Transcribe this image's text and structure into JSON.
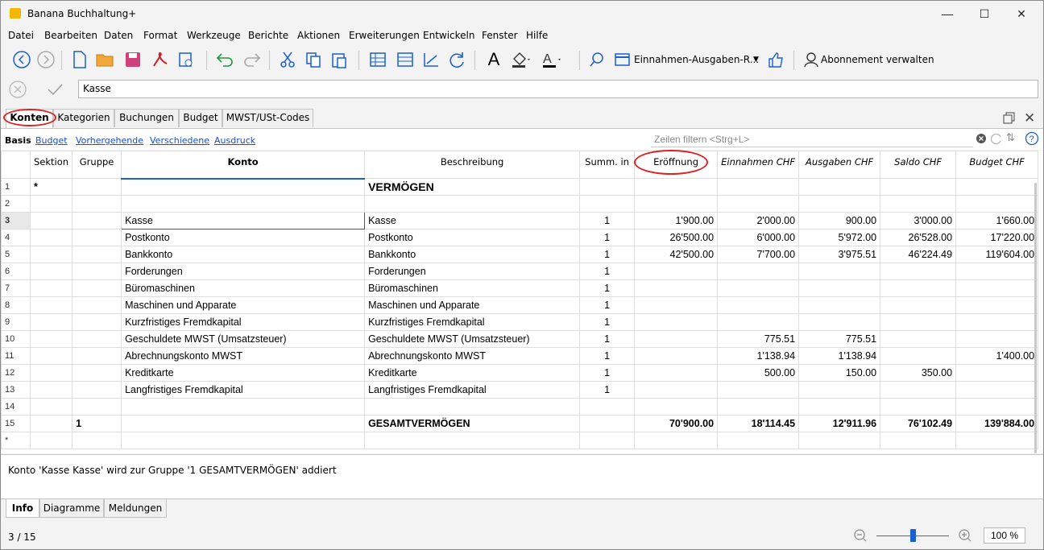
{
  "app": {
    "title": "Banana Buchhaltung+"
  },
  "window_controls": {
    "minimize": "—",
    "maximize": "☐",
    "close": "✕"
  },
  "menu": [
    "Datei",
    "Bearbeiten",
    "Daten",
    "Format",
    "Werkzeuge",
    "Berichte",
    "Aktionen",
    "Erweiterungen",
    "Entwickeln",
    "Fenster",
    "Hilfe"
  ],
  "toolbar": {
    "layout_combo": "Einnahmen-Ausgaben-R...",
    "abo_label": "Abonnement verwalten"
  },
  "edit": {
    "value": "Kasse"
  },
  "tabs": [
    "Konten",
    "Kategorien",
    "Buchungen",
    "Budget",
    "MWST/USt-Codes"
  ],
  "subtabs": {
    "current": "Basis",
    "links": [
      "Budget",
      "Vorhergehende",
      "Verschiedene",
      "Ausdruck"
    ]
  },
  "filter": {
    "placeholder": "Zeilen filtern <Strg+L>"
  },
  "table": {
    "headers": [
      "Sektion",
      "Gruppe",
      "Konto",
      "Beschreibung",
      "Summ. in",
      "Eröffnung",
      "Einnahmen CHF",
      "Ausgaben CHF",
      "Saldo CHF",
      "Budget CHF"
    ],
    "rows": [
      [
        "1",
        "*",
        "",
        "",
        "VERMÖGEN",
        "",
        "",
        "",
        "",
        "",
        ""
      ],
      [
        "2",
        "",
        "",
        "",
        "",
        "",
        "",
        "",
        "",
        "",
        ""
      ],
      [
        "3",
        "",
        "",
        "Kasse",
        "Kasse",
        "1",
        "1'900.00",
        "2'000.00",
        "900.00",
        "3'000.00",
        "1'660.00"
      ],
      [
        "4",
        "",
        "",
        "Postkonto",
        "Postkonto",
        "1",
        "26'500.00",
        "6'000.00",
        "5'972.00",
        "26'528.00",
        "17'220.00"
      ],
      [
        "5",
        "",
        "",
        "Bankkonto",
        "Bankkonto",
        "1",
        "42'500.00",
        "7'700.00",
        "3'975.51",
        "46'224.49",
        "119'604.00"
      ],
      [
        "6",
        "",
        "",
        "Forderungen",
        "Forderungen",
        "1",
        "",
        "",
        "",
        "",
        ""
      ],
      [
        "7",
        "",
        "",
        "Büromaschinen",
        "Büromaschinen",
        "1",
        "",
        "",
        "",
        "",
        ""
      ],
      [
        "8",
        "",
        "",
        "Maschinen und Apparate",
        "Maschinen und Apparate",
        "1",
        "",
        "",
        "",
        "",
        ""
      ],
      [
        "9",
        "",
        "",
        "Kurzfristiges Fremdkapital",
        "Kurzfristiges Fremdkapital",
        "1",
        "",
        "",
        "",
        "",
        ""
      ],
      [
        "10",
        "",
        "",
        "Geschuldete MWST (Umsatzsteuer)",
        "Geschuldete MWST (Umsatzsteuer)",
        "1",
        "",
        "775.51",
        "775.51",
        "",
        ""
      ],
      [
        "11",
        "",
        "",
        "Abrechnungskonto MWST",
        "Abrechnungskonto MWST",
        "1",
        "",
        "1'138.94",
        "1'138.94",
        "",
        "1'400.00"
      ],
      [
        "12",
        "",
        "",
        "Kreditkarte",
        "Kreditkarte",
        "1",
        "",
        "500.00",
        "150.00",
        "350.00",
        ""
      ],
      [
        "13",
        "",
        "",
        "Langfristiges Fremdkapital",
        "Langfristiges Fremdkapital",
        "1",
        "",
        "",
        "",
        "",
        ""
      ],
      [
        "14",
        "",
        "",
        "",
        "",
        "",
        "",
        "",
        "",
        "",
        ""
      ],
      [
        "15",
        "",
        "1",
        "",
        "GESAMTVERMÖGEN",
        "",
        "70'900.00",
        "18'114.45",
        "12'911.96",
        "76'102.49",
        "139'884.00"
      ],
      [
        "*",
        "",
        "",
        "",
        "",
        "",
        "",
        "",
        "",
        "",
        ""
      ]
    ]
  },
  "info": {
    "message": "Konto 'Kasse Kasse' wird zur Gruppe '1 GESAMTVERMÖGEN' addiert"
  },
  "bottom_tabs": [
    "Info",
    "Diagramme",
    "Meldungen"
  ],
  "status": {
    "position": "3 / 15",
    "zoom": "100 %"
  }
}
